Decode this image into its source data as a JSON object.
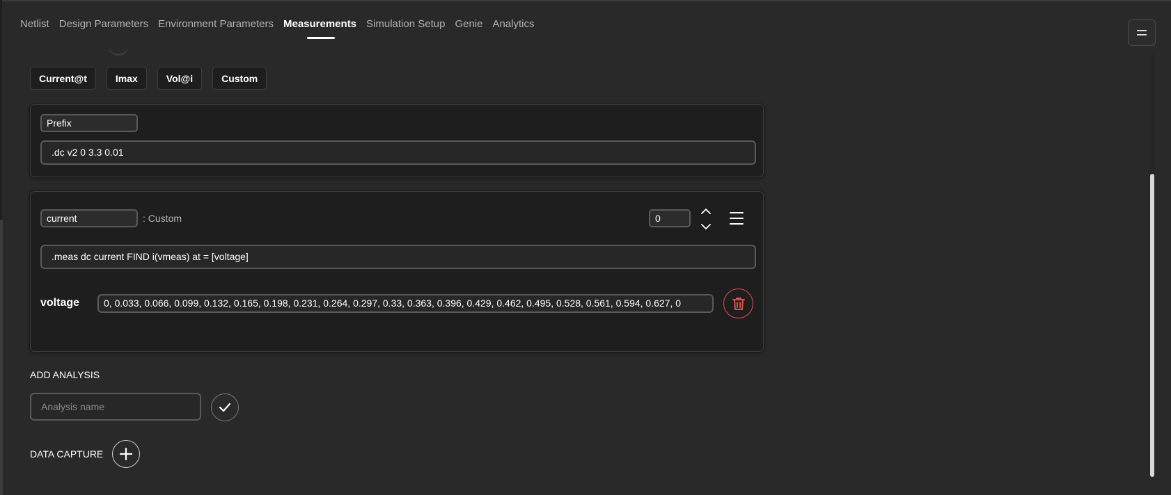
{
  "tabs": [
    {
      "label": "Netlist"
    },
    {
      "label": "Design Parameters"
    },
    {
      "label": "Environment Parameters"
    },
    {
      "label": "Measurements",
      "active": true
    },
    {
      "label": "Simulation Setup"
    },
    {
      "label": "Genie"
    },
    {
      "label": "Analytics"
    }
  ],
  "menu_icon": "hamburger-icon",
  "measure_types": [
    {
      "label": "Current@t"
    },
    {
      "label": "Imax"
    },
    {
      "label": "Vol@i"
    },
    {
      "label": "Custom"
    }
  ],
  "prefix_panel": {
    "name": "Prefix",
    "command": ".dc v2 0 3.3 0.01"
  },
  "measurement": {
    "name": "current",
    "type_label": ": Custom",
    "order": "0",
    "command": ".meas dc current FIND i(vmeas) at = [voltage]",
    "param_label": "voltage",
    "param_value": "0, 0.033, 0.066, 0.099, 0.132, 0.165, 0.198, 0.231, 0.264, 0.297, 0.33, 0.363, 0.396, 0.429, 0.462, 0.495, 0.528, 0.561, 0.594, 0.627, 0",
    "delete_color": "#e14d4d"
  },
  "add_analysis": {
    "label": "ADD ANALYSIS",
    "placeholder": "Analysis name"
  },
  "data_capture": {
    "label": "DATA CAPTURE"
  }
}
